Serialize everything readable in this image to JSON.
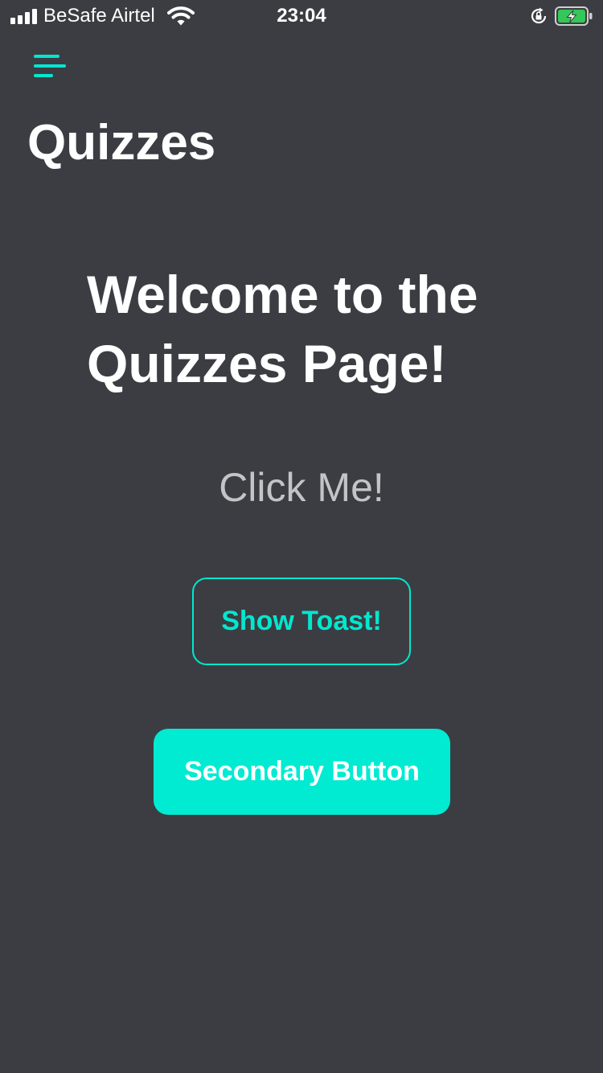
{
  "status_bar": {
    "carrier": "BeSafe Airtel",
    "time": "23:04",
    "signal_icon": "signal-bars-icon",
    "wifi_icon": "wifi-icon",
    "rotation_lock_icon": "rotation-lock-icon",
    "battery_icon": "battery-charging-icon",
    "battery_color": "#34c759"
  },
  "header": {
    "menu_icon": "hamburger-menu-icon",
    "title": "Quizzes"
  },
  "main": {
    "welcome_heading": "Welcome to the Quizzes Page!",
    "click_me_label": "Click Me!",
    "show_toast_label": "Show Toast!",
    "secondary_button_label": "Secondary Button"
  },
  "colors": {
    "background": "#3c3d42",
    "accent": "#00e8cf",
    "muted_text": "#c4c4c7"
  }
}
